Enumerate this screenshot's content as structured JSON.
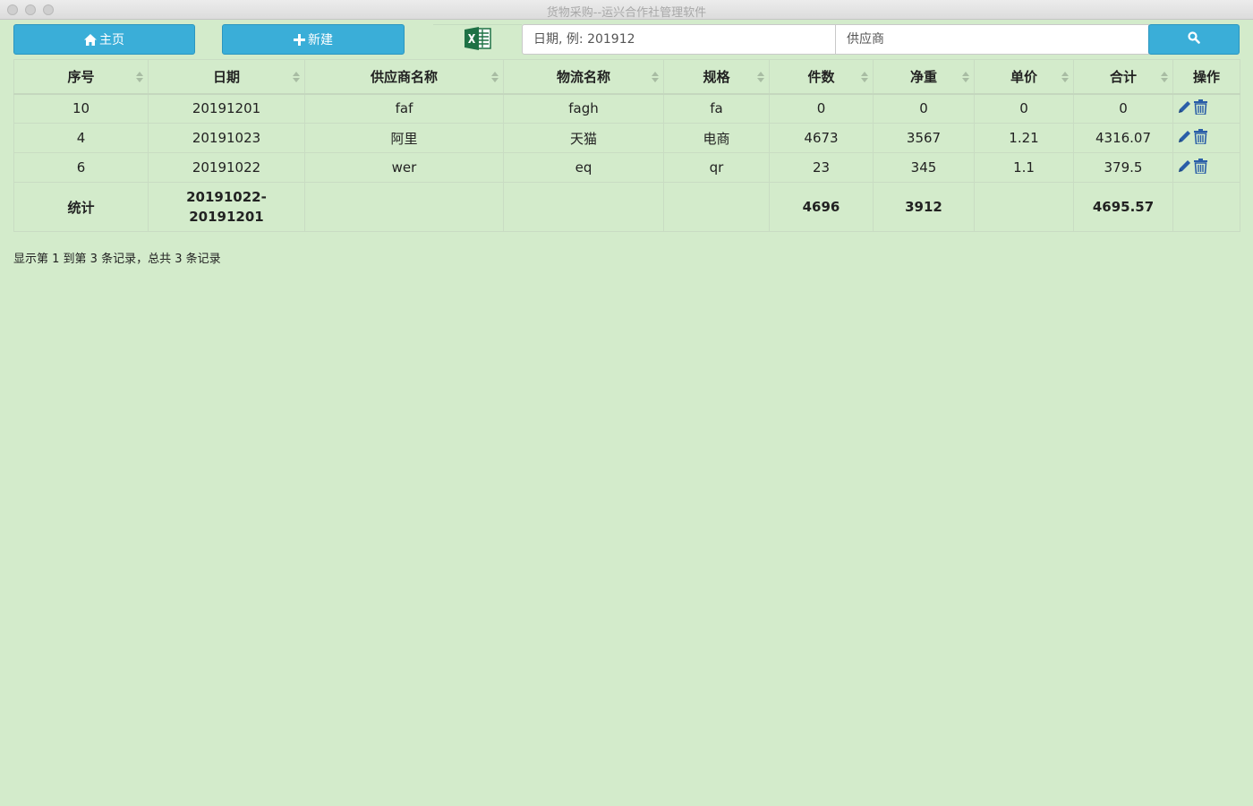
{
  "window": {
    "title": "货物采购--运兴合作社管理软件"
  },
  "toolbar": {
    "home_label": "主页",
    "new_label": "新建",
    "date_placeholder": "日期, 例: 201912",
    "supplier_placeholder": "供应商",
    "accent_color": "#3aaed8"
  },
  "table": {
    "headers": [
      "序号",
      "日期",
      "供应商名称",
      "物流名称",
      "规格",
      "件数",
      "净重",
      "单价",
      "合计",
      "操作"
    ],
    "rows": [
      [
        "10",
        "20191201",
        "faf",
        "fagh",
        "fa",
        "0",
        "0",
        "0",
        "0"
      ],
      [
        "4",
        "20191023",
        "阿里",
        "天猫",
        "电商",
        "4673",
        "3567",
        "1.21",
        "4316.07"
      ],
      [
        "6",
        "20191022",
        "wer",
        "eq",
        "qr",
        "23",
        "345",
        "1.1",
        "379.5"
      ]
    ],
    "total": {
      "label": "统计",
      "range_start": "20191022-",
      "range_end": "20191201",
      "count": "4696",
      "weight": "3912",
      "sum": "4695.57"
    }
  },
  "footer": {
    "summary": "显示第 1 到第 3 条记录，总共 3 条记录"
  },
  "colors": {
    "background": "#d3ebcb",
    "icon": "#2a5ea8"
  }
}
